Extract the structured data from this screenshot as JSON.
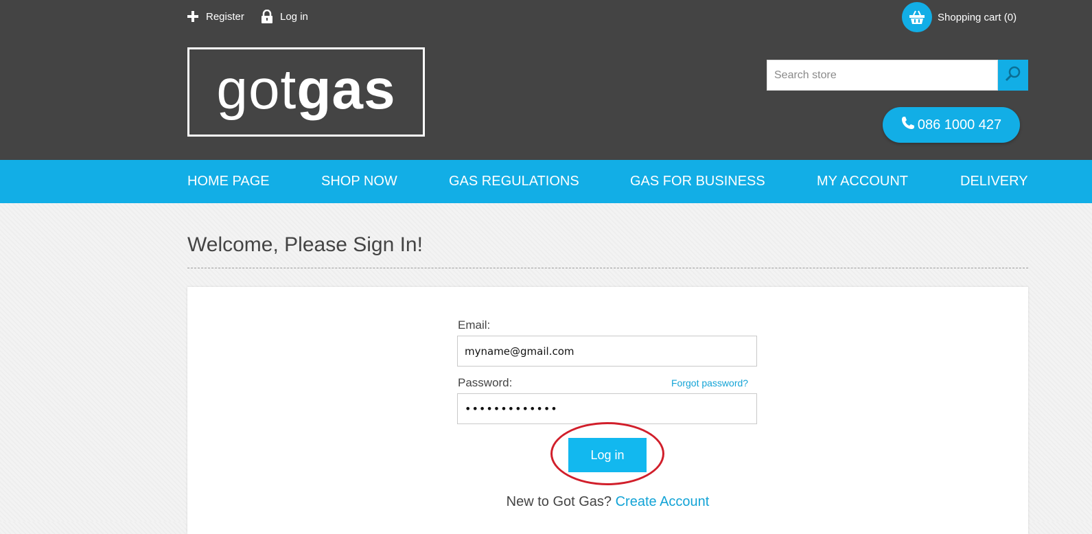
{
  "topbar": {
    "register_label": "Register",
    "login_label": "Log in",
    "cart_label": "Shopping cart (0)"
  },
  "brand": {
    "logo_light": "got",
    "logo_bold": "gas",
    "accent_color": "#12aee6",
    "header_color": "#444444"
  },
  "search": {
    "placeholder": "Search store"
  },
  "phone": {
    "number": "086 1000 427"
  },
  "nav": {
    "items": [
      {
        "label": "HOME PAGE"
      },
      {
        "label": "SHOP NOW"
      },
      {
        "label": "GAS REGULATIONS"
      },
      {
        "label": "GAS FOR BUSINESS"
      },
      {
        "label": "MY ACCOUNT"
      },
      {
        "label": "DELIVERY"
      }
    ]
  },
  "main": {
    "title": "Welcome, Please Sign In!",
    "email_label": "Email:",
    "email_value": "myname@gmail.com",
    "password_label": "Password:",
    "password_value": "•••••••••••••",
    "forgot_label": "Forgot password?",
    "login_button": "Log in",
    "new_prompt": "New to Got Gas?",
    "create_account": "Create Account"
  }
}
